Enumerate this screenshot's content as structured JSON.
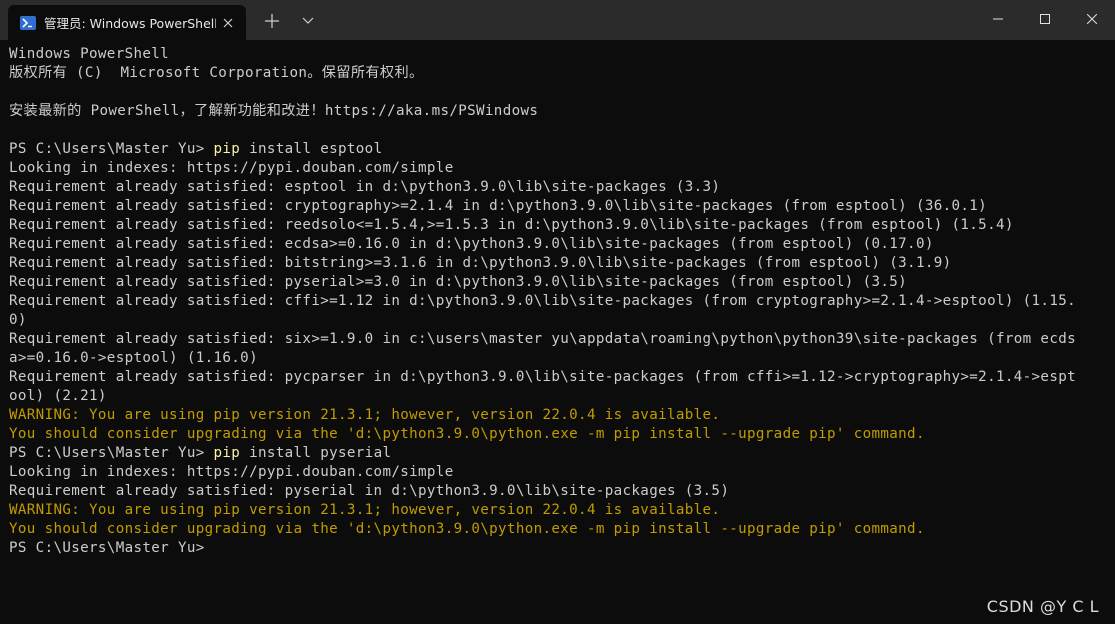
{
  "window": {
    "tab_title": "管理员: Windows PowerShell",
    "tab_icon": "powershell-icon",
    "accent": "#2f6fd0"
  },
  "terminal": {
    "lines": [
      {
        "type": "normal",
        "text": "Windows PowerShell"
      },
      {
        "type": "normal",
        "text": "版权所有 (C)  Microsoft Corporation。保留所有权利。"
      },
      {
        "type": "normal",
        "text": ""
      },
      {
        "type": "normal",
        "text": "安装最新的 PowerShell，了解新功能和改进！https://aka.ms/PSWindows"
      },
      {
        "type": "normal",
        "text": ""
      },
      {
        "type": "prompt",
        "prompt": "PS C:\\Users\\Master Yu> ",
        "cmd": "pip",
        "args": " install esptool"
      },
      {
        "type": "normal",
        "text": "Looking in indexes: https://pypi.douban.com/simple"
      },
      {
        "type": "normal",
        "text": "Requirement already satisfied: esptool in d:\\python3.9.0\\lib\\site-packages (3.3)"
      },
      {
        "type": "normal",
        "text": "Requirement already satisfied: cryptography>=2.1.4 in d:\\python3.9.0\\lib\\site-packages (from esptool) (36.0.1)"
      },
      {
        "type": "normal",
        "text": "Requirement already satisfied: reedsolo<=1.5.4,>=1.5.3 in d:\\python3.9.0\\lib\\site-packages (from esptool) (1.5.4)"
      },
      {
        "type": "normal",
        "text": "Requirement already satisfied: ecdsa>=0.16.0 in d:\\python3.9.0\\lib\\site-packages (from esptool) (0.17.0)"
      },
      {
        "type": "normal",
        "text": "Requirement already satisfied: bitstring>=3.1.6 in d:\\python3.9.0\\lib\\site-packages (from esptool) (3.1.9)"
      },
      {
        "type": "normal",
        "text": "Requirement already satisfied: pyserial>=3.0 in d:\\python3.9.0\\lib\\site-packages (from esptool) (3.5)"
      },
      {
        "type": "normal",
        "text": "Requirement already satisfied: cffi>=1.12 in d:\\python3.9.0\\lib\\site-packages (from cryptography>=2.1.4->esptool) (1.15."
      },
      {
        "type": "normal",
        "text": "0)"
      },
      {
        "type": "normal",
        "text": "Requirement already satisfied: six>=1.9.0 in c:\\users\\master yu\\appdata\\roaming\\python\\python39\\site-packages (from ecds"
      },
      {
        "type": "normal",
        "text": "a>=0.16.0->esptool) (1.16.0)"
      },
      {
        "type": "normal",
        "text": "Requirement already satisfied: pycparser in d:\\python3.9.0\\lib\\site-packages (from cffi>=1.12->cryptography>=2.1.4->espt"
      },
      {
        "type": "normal",
        "text": "ool) (2.21)"
      },
      {
        "type": "warn",
        "text": "WARNING: You are using pip version 21.3.1; however, version 22.0.4 is available."
      },
      {
        "type": "warn",
        "text": "You should consider upgrading via the 'd:\\python3.9.0\\python.exe -m pip install --upgrade pip' command."
      },
      {
        "type": "prompt",
        "prompt": "PS C:\\Users\\Master Yu> ",
        "cmd": "pip",
        "args": " install pyserial"
      },
      {
        "type": "normal",
        "text": "Looking in indexes: https://pypi.douban.com/simple"
      },
      {
        "type": "normal",
        "text": "Requirement already satisfied: pyserial in d:\\python3.9.0\\lib\\site-packages (3.5)"
      },
      {
        "type": "warn",
        "text": "WARNING: You are using pip version 21.3.1; however, version 22.0.4 is available."
      },
      {
        "type": "warn",
        "text": "You should consider upgrading via the 'd:\\python3.9.0\\python.exe -m pip install --upgrade pip' command."
      },
      {
        "type": "normal",
        "text": "PS C:\\Users\\Master Yu>"
      }
    ]
  },
  "watermark": "CSDN @Y C  L",
  "colors": {
    "background": "#0c0c0c",
    "text": "#cccccc",
    "warning": "#c19c00",
    "command": "#f9f1a5"
  }
}
